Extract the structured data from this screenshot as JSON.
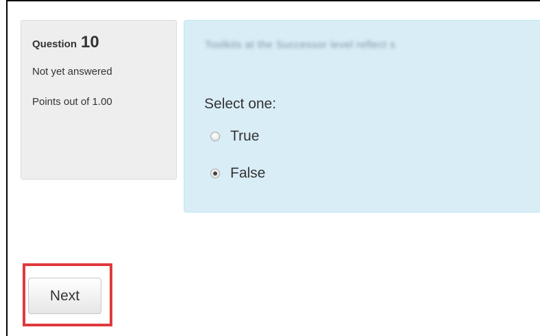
{
  "question": {
    "label": "Question",
    "number": "10",
    "status": "Not yet answered",
    "points": "Points out of 1.00"
  },
  "content": {
    "blurred_question": "Toolkits at the Successor level reflect s",
    "prompt": "Select one:",
    "options": [
      {
        "label": "True",
        "selected": false
      },
      {
        "label": "False",
        "selected": true
      }
    ]
  },
  "navigation": {
    "next_label": "Next"
  },
  "colors": {
    "info_bg": "#eeeeee",
    "content_bg": "#d9edf7",
    "highlight": "#e0393e"
  }
}
